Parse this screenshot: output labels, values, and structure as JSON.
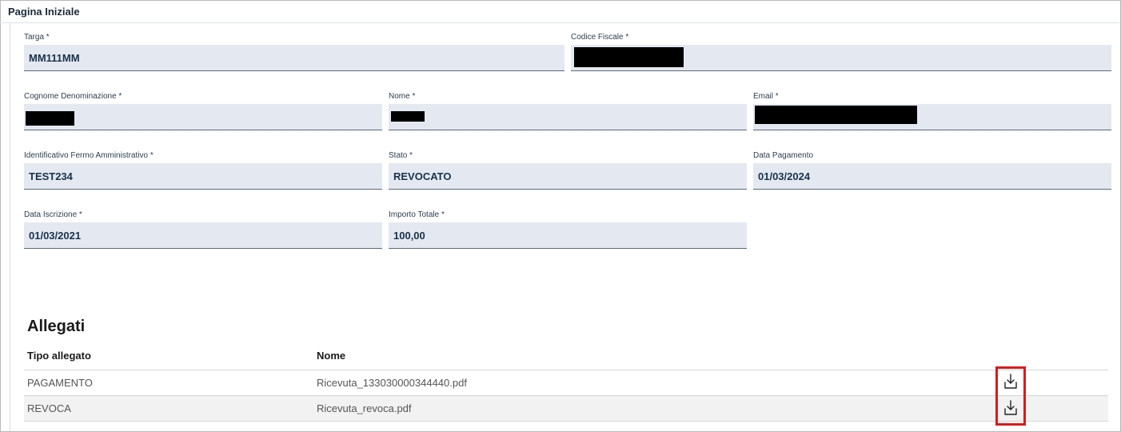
{
  "page": {
    "title": "Pagina Iniziale"
  },
  "fields": {
    "targa": {
      "label": "Targa *",
      "value": "MM111MM"
    },
    "codice_fiscale": {
      "label": "Codice Fiscale *",
      "value": ""
    },
    "cognome": {
      "label": "Cognome Denominazione *",
      "value": ""
    },
    "nome": {
      "label": "Nome *",
      "value": ""
    },
    "email": {
      "label": "Email *",
      "value": ""
    },
    "identificativo": {
      "label": "Identificativo Fermo Amministrativo *",
      "value": "TEST234"
    },
    "stato": {
      "label": "Stato *",
      "value": "REVOCATO"
    },
    "data_pagamento": {
      "label": "Data Pagamento",
      "value": "01/03/2024"
    },
    "data_iscrizione": {
      "label": "Data Iscrizione *",
      "value": "01/03/2021"
    },
    "importo_totale": {
      "label": "Importo Totale *",
      "value": "100,00"
    }
  },
  "allegati": {
    "title": "Allegati",
    "columns": [
      "Tipo allegato",
      "Nome"
    ],
    "rows": [
      {
        "tipo": "PAGAMENTO",
        "nome": "Ricevuta_133030000344440.pdf",
        "action_icon": "download-icon"
      },
      {
        "tipo": "REVOCA",
        "nome": "Ricevuta_revoca.pdf",
        "action_icon": "download-icon"
      }
    ]
  },
  "colors": {
    "field_bg": "#e4e8f0",
    "field_text": "#17324d",
    "highlight": "#d81b1b"
  }
}
